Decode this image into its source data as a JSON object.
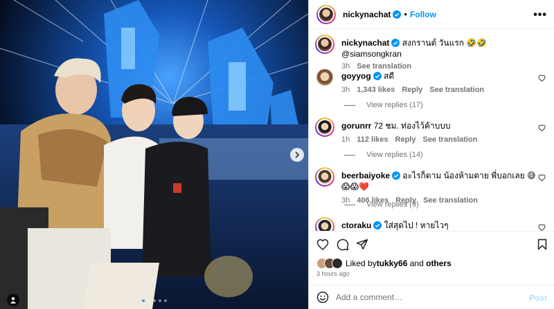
{
  "post": {
    "author": "nickynachat",
    "follow_label": "Follow",
    "more_label": "•••",
    "carousel_dots": 5,
    "carousel_active": 1
  },
  "caption": {
    "username": "nickynachat",
    "text": "สงกรานต์ วันแรก 🤣🤣 @siamsongkran",
    "time": "3h",
    "see_translation": "See translation"
  },
  "comments": [
    {
      "username": "goyyog",
      "verified": true,
      "text": "สดี",
      "time": "3h",
      "likes": "1,343 likes",
      "reply": "Reply",
      "see_translation": "See translation",
      "view_replies": "View replies (17)"
    },
    {
      "username": "gorunrr",
      "verified": false,
      "text": "72 ชม. ท่องไว้ค้าบบบ",
      "time": "1h",
      "likes": "112 likes",
      "reply": "Reply",
      "see_translation": "See translation",
      "view_replies": "View replies (14)"
    },
    {
      "username": "beerbaiyoke",
      "verified": true,
      "text": "อะไรก็ตาม น้องห้ามตาย พี่บอกเลย 😅😱😱❤️",
      "time": "3h",
      "likes": "406 likes",
      "reply": "Reply",
      "see_translation": "See translation",
      "view_replies": "View replies (9)"
    },
    {
      "username": "ctoraku",
      "verified": true,
      "text": "ใส่สุดไป ! หายไวๆ"
    }
  ],
  "likes_line": {
    "prefix": "Liked by ",
    "user": "tukky66",
    "middle": " and ",
    "others": "others"
  },
  "timestamp": "3 hours ago",
  "add_comment": {
    "placeholder": "Add a comment…",
    "post_label": "Post"
  },
  "icons": [
    "chevron-right-icon",
    "user-tag-icon",
    "verified-icon",
    "heart-icon",
    "comment-icon",
    "share-icon",
    "bookmark-icon",
    "emoji-icon"
  ],
  "colors": {
    "accent": "#0095f6",
    "verified": "#0095f6",
    "muted": "#737373"
  }
}
